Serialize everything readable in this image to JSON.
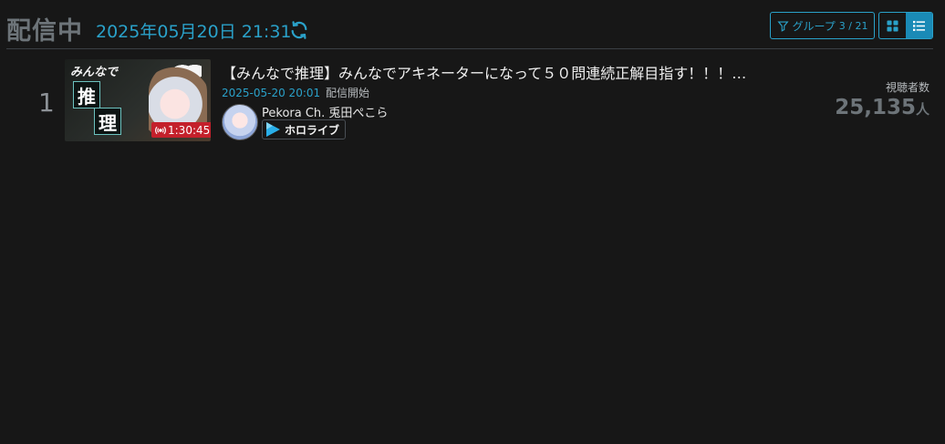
{
  "header": {
    "title": "配信中",
    "datetime": "2025年05月20日 21:31",
    "refresh_icon": "refresh-icon",
    "group_button": {
      "label": "グループ",
      "count": "3 / 21",
      "icon": "filter-icon"
    },
    "view_modes": [
      {
        "name": "grid-view",
        "icon": "grid-icon",
        "active": false
      },
      {
        "name": "list-view",
        "icon": "list-icon",
        "active": true
      }
    ]
  },
  "streams": [
    {
      "rank": "1",
      "thumbnail": {
        "text": "みんなで",
        "kanji": [
          "推",
          "理"
        ],
        "duration": "1:30:45",
        "live_icon": "broadcast-icon"
      },
      "title": "【みんなで推理】みんなでアキネーターになって５０問連続正解目指す！！！…",
      "start_time": "2025-05-20 20:01",
      "start_label": "配信開始",
      "channel_name": "Pekora Ch. 兎田ぺこら",
      "organization": "ホロライブ",
      "viewer_label": "視聴者数",
      "viewer_count": "25,135",
      "viewer_unit": "人"
    }
  ],
  "colors": {
    "background": "#171717",
    "accent": "#2aa1c9",
    "muted": "#6d7479",
    "live": "#c4202b"
  }
}
